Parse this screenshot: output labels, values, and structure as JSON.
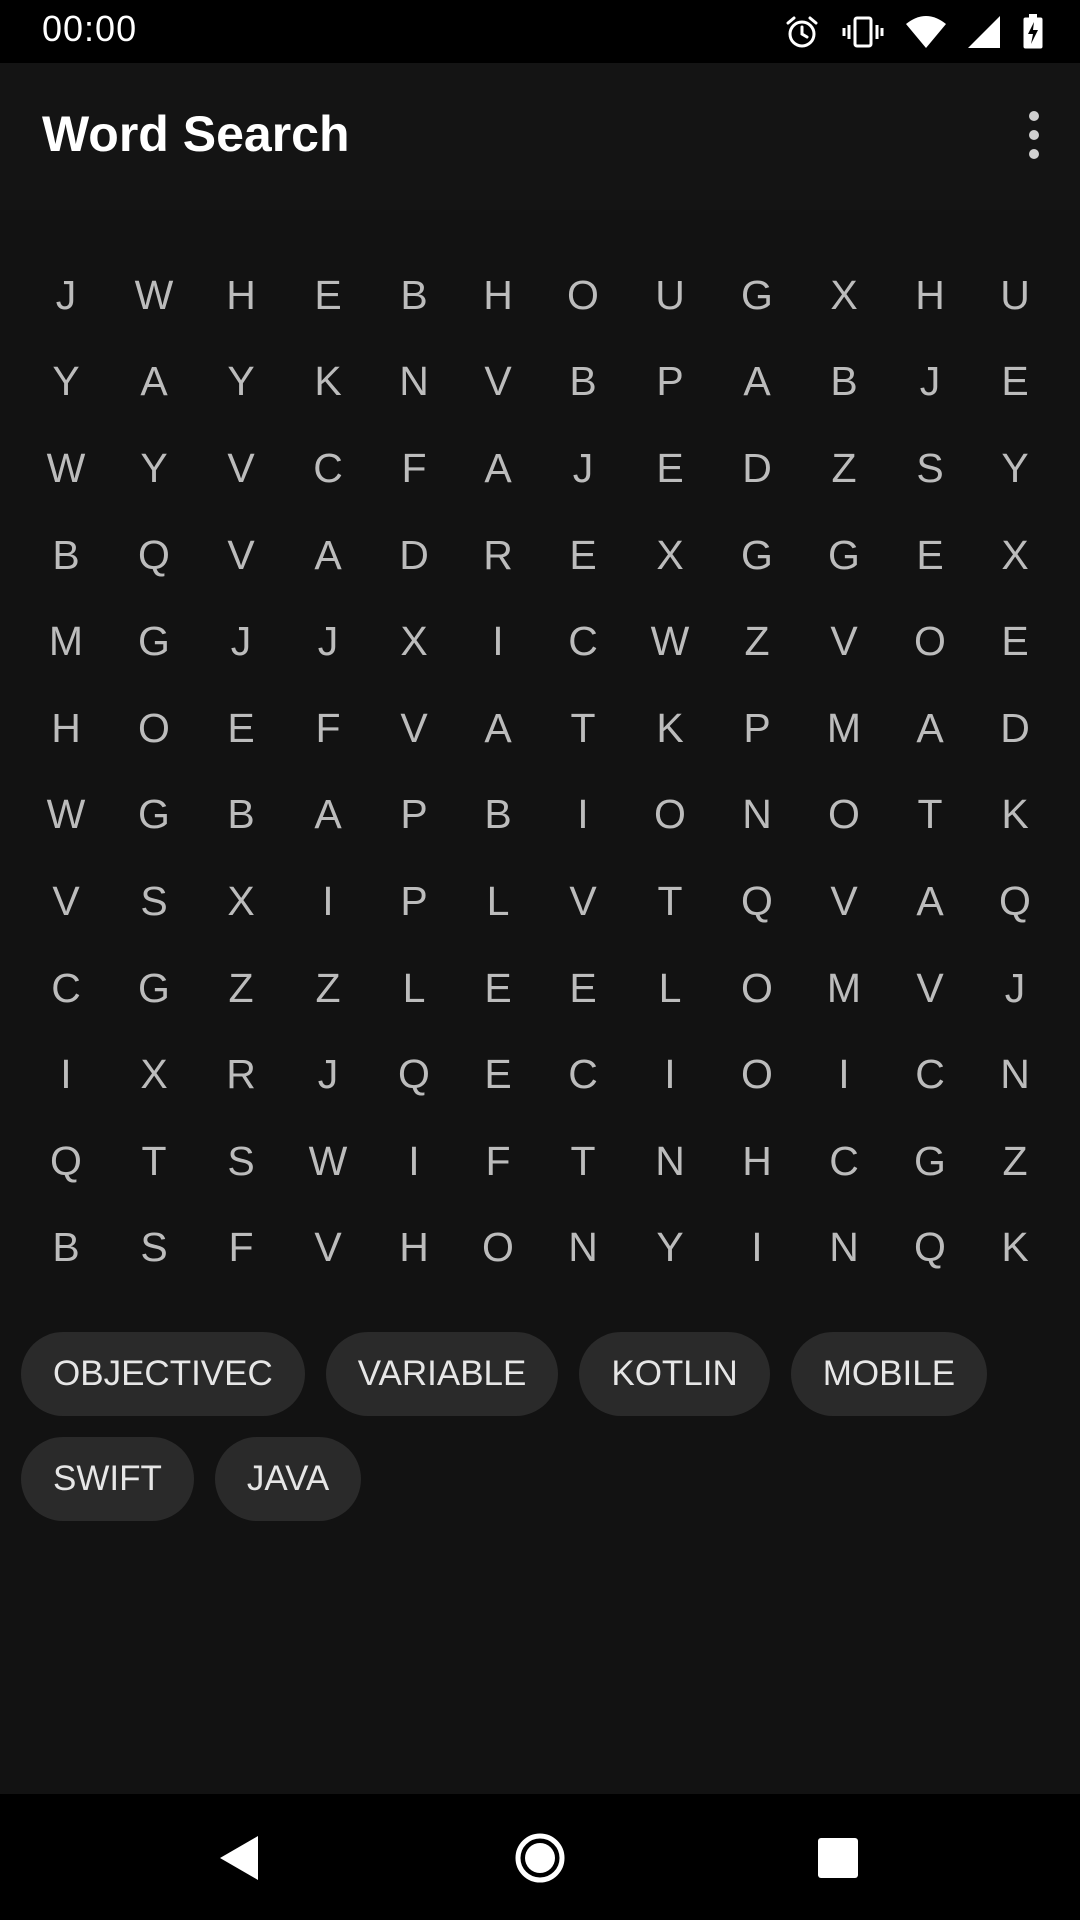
{
  "status_bar": {
    "time": "00:00",
    "icons": [
      "alarm-icon",
      "vibrate-icon",
      "wifi-icon",
      "signal-icon",
      "battery-charging-icon"
    ]
  },
  "app_bar": {
    "title": "Word Search",
    "menu_icon": "more-vert-icon"
  },
  "grid": {
    "rows": [
      [
        "J",
        "W",
        "H",
        "E",
        "B",
        "H",
        "O",
        "U",
        "G",
        "X",
        "H",
        "U"
      ],
      [
        "Y",
        "A",
        "Y",
        "K",
        "N",
        "V",
        "B",
        "P",
        "A",
        "B",
        "J",
        "E"
      ],
      [
        "W",
        "Y",
        "V",
        "C",
        "F",
        "A",
        "J",
        "E",
        "D",
        "Z",
        "S",
        "Y"
      ],
      [
        "B",
        "Q",
        "V",
        "A",
        "D",
        "R",
        "E",
        "X",
        "G",
        "G",
        "E",
        "X"
      ],
      [
        "M",
        "G",
        "J",
        "J",
        "X",
        "I",
        "C",
        "W",
        "Z",
        "V",
        "O",
        "E"
      ],
      [
        "H",
        "O",
        "E",
        "F",
        "V",
        "A",
        "T",
        "K",
        "P",
        "M",
        "A",
        "D"
      ],
      [
        "W",
        "G",
        "B",
        "A",
        "P",
        "B",
        "I",
        "O",
        "N",
        "O",
        "T",
        "K"
      ],
      [
        "V",
        "S",
        "X",
        "I",
        "P",
        "L",
        "V",
        "T",
        "Q",
        "V",
        "A",
        "Q"
      ],
      [
        "C",
        "G",
        "Z",
        "Z",
        "L",
        "E",
        "E",
        "L",
        "O",
        "M",
        "V",
        "J"
      ],
      [
        "I",
        "X",
        "R",
        "J",
        "Q",
        "E",
        "C",
        "I",
        "O",
        "I",
        "C",
        "N"
      ],
      [
        "Q",
        "T",
        "S",
        "W",
        "I",
        "F",
        "T",
        "N",
        "H",
        "C",
        "G",
        "Z"
      ],
      [
        "B",
        "S",
        "F",
        "V",
        "H",
        "O",
        "N",
        "Y",
        "I",
        "N",
        "Q",
        "K"
      ]
    ]
  },
  "words": [
    {
      "label": "OBJECTIVEC"
    },
    {
      "label": "VARIABLE"
    },
    {
      "label": "KOTLIN"
    },
    {
      "label": "MOBILE"
    },
    {
      "label": "SWIFT"
    },
    {
      "label": "JAVA"
    }
  ],
  "nav_bar": {
    "icons": [
      "back-icon",
      "home-icon",
      "recents-icon"
    ]
  },
  "colors": {
    "background": "#121212",
    "letter": "#bcbcbc",
    "chip_bg": "#2a2a2a",
    "chip_text": "#e6e6e6"
  }
}
